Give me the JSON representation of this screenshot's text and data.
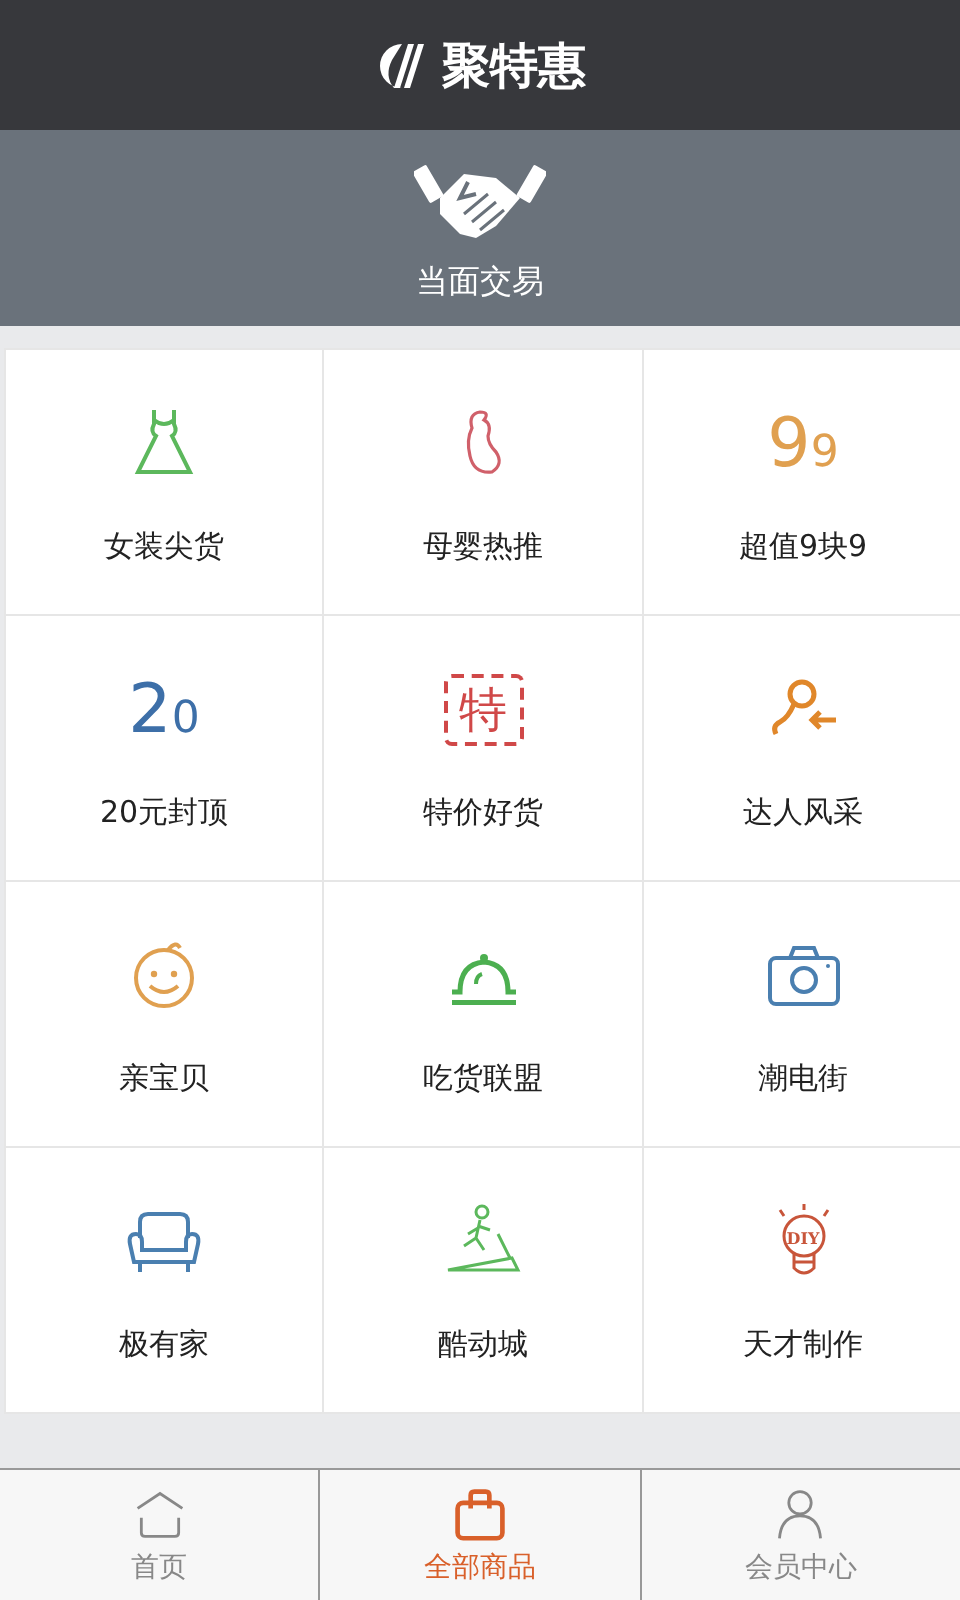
{
  "header": {
    "title": "聚特惠"
  },
  "banner": {
    "label": "当面交易"
  },
  "categories": [
    {
      "kind": "dress",
      "label": "女装尖货",
      "color": "#5cb85c"
    },
    {
      "kind": "mother",
      "label": "母婴热推",
      "color": "#d0606a"
    },
    {
      "kind": "digits",
      "label": "超值9块9",
      "color": "#e0a050",
      "icon_text": "9",
      "icon_sub": "9"
    },
    {
      "kind": "digits",
      "label": "20元封顶",
      "color": "#3d6fa8",
      "icon_text": "2",
      "icon_sub": "0"
    },
    {
      "kind": "stamp",
      "label": "特价好货",
      "color": "#d04848",
      "icon_text": "特"
    },
    {
      "kind": "person",
      "label": "达人风采",
      "color": "#e0872a"
    },
    {
      "kind": "baby",
      "label": "亲宝贝",
      "color": "#e0a050"
    },
    {
      "kind": "dish",
      "label": "吃货联盟",
      "color": "#4caf50"
    },
    {
      "kind": "camera",
      "label": "潮电街",
      "color": "#4a7fb0"
    },
    {
      "kind": "sofa",
      "label": "极有家",
      "color": "#4a7fb0"
    },
    {
      "kind": "treadmill",
      "label": "酷动城",
      "color": "#5cb85c"
    },
    {
      "kind": "bulb",
      "label": "天才制作",
      "color": "#c8553a",
      "icon_text": "DIY"
    }
  ],
  "tabs": [
    {
      "kind": "home",
      "label": "首页",
      "selected": false
    },
    {
      "kind": "bag",
      "label": "全部商品",
      "selected": true
    },
    {
      "kind": "user",
      "label": "会员中心",
      "selected": false
    }
  ]
}
